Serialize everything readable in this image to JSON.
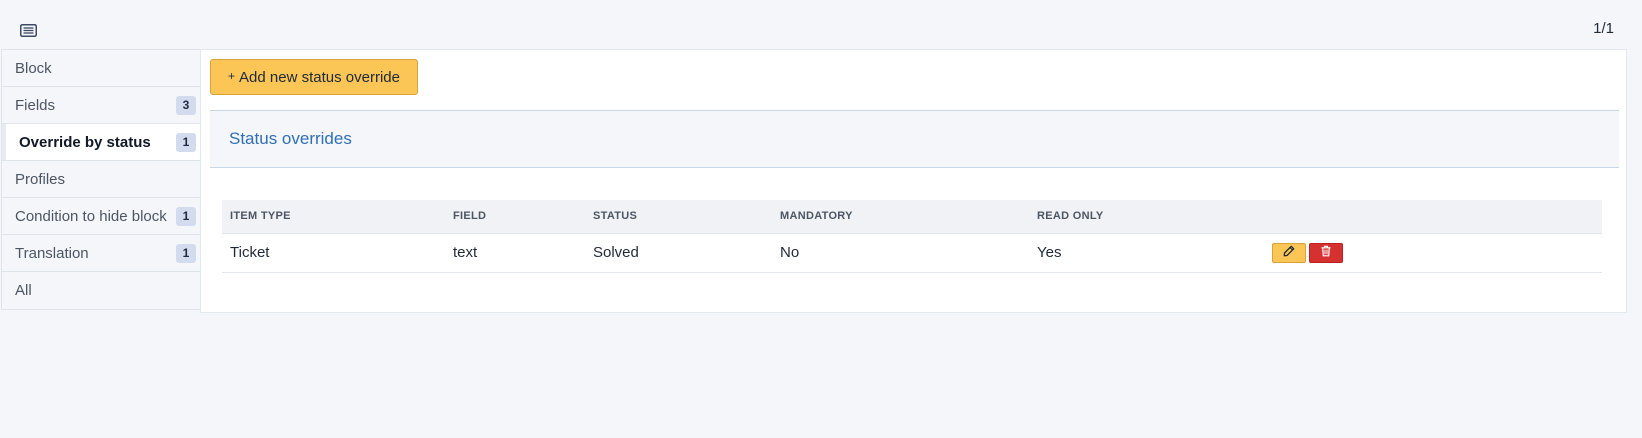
{
  "toolbar": {
    "list_icon": "list-icon",
    "pager": "1/1"
  },
  "tabs": [
    {
      "label": "Block",
      "count": null
    },
    {
      "label": "Fields",
      "count": "3"
    },
    {
      "label": "Override by status",
      "count": "1",
      "active": true
    },
    {
      "label": "Profiles",
      "count": null
    },
    {
      "label": "Condition to hide block",
      "count": "1"
    },
    {
      "label": "Translation",
      "count": "1"
    },
    {
      "label": "All",
      "count": null
    }
  ],
  "panel": {
    "add_button": {
      "icon": "+",
      "label": "Add new status override"
    },
    "section_title": "Status overrides",
    "table": {
      "headers": [
        "ITEM TYPE",
        "FIELD",
        "STATUS",
        "MANDATORY",
        "READ ONLY"
      ],
      "rows": [
        {
          "item_type": "Ticket",
          "field": "text",
          "status": "Solved",
          "mandatory": "No",
          "read_only": "Yes"
        }
      ],
      "row_actions": {
        "edit_icon": "pencil-icon",
        "delete_icon": "trash-icon"
      }
    }
  },
  "colors": {
    "accent_yellow": "#fbc655",
    "danger_red": "#d63131",
    "link_blue": "#2f6fb4"
  }
}
